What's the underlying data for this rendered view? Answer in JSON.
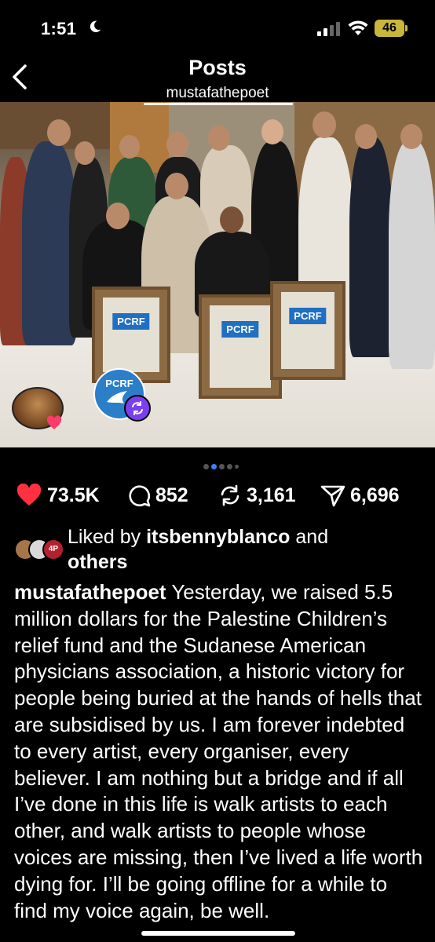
{
  "status_bar": {
    "time": "1:51",
    "battery": "46",
    "accent_battery": "#c8b73a"
  },
  "header": {
    "title": "Posts",
    "subtitle": "mustafathepoet"
  },
  "photo": {
    "badge_text": "PCRF",
    "frame_logo": "PCRF"
  },
  "pager": {
    "count": 5,
    "active_index": 1
  },
  "actions": {
    "likes": "73.5K",
    "comments": "852",
    "reposts": "3,161",
    "shares": "6,696"
  },
  "liked_by": {
    "prefix": "Liked by",
    "user": "itsbennyblanco",
    "suffix": "and",
    "others": "others",
    "badge": "4P"
  },
  "caption": {
    "author": "mustafathepoet",
    "text": "Yesterday, we raised 5.5 million dollars for the Palestine Children’s relief fund and the Sudanese American physicians association, a historic victory for people being buried at the hands of hells that are subsidised by us. I am forever indebted to every artist, every organiser, every believer. I am nothing but a bridge and if all I’ve done in this life is walk artists to each other, and walk artists to people whose voices are missing, then I’ve lived a life worth dying for. I’ll be going offline for a while to find my voice again, be well."
  },
  "colors": {
    "like_red": "#ff3040",
    "active_dot": "#3b82f6",
    "repost_purple": "#7b3ff2",
    "pcrf_blue": "#2b7fc9"
  }
}
